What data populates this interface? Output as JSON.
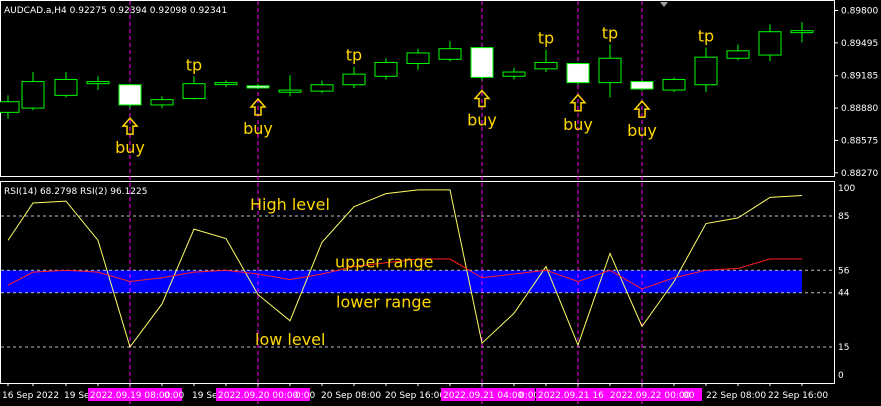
{
  "header": {
    "symbol": "AUDCAD.a,H4",
    "ohlc": "0.92275 0.92394 0.92098 0.92341"
  },
  "rsi_header": "RSI(14) 68.2798  RSI(2) 96.1225",
  "annotations": {
    "buy": "buy",
    "tp": "tp",
    "high_level": "High level",
    "upper_range": "upper range",
    "lower_range": "lower range",
    "low_level": "low level"
  },
  "colors": {
    "bull": "#00ff00",
    "bear_body": "#ffffff",
    "rsi14": "#ff2020",
    "rsi2": "#ffff66",
    "band": "#0000ff",
    "highlight": "#ff00ff",
    "annotation": "#ffd700"
  },
  "chart_data": [
    {
      "type": "candlestick",
      "series_label": "AUDCAD.a,H4",
      "y_ticks": [
        0.898,
        0.89495,
        0.89185,
        0.8888,
        0.88575,
        0.8827
      ],
      "ylim": [
        0.8824,
        0.8988
      ],
      "x_ticks": [
        "16 Sep 2022",
        "19 Sep 16:00",
        "20 Sep 08:00",
        "20 Sep 16:00",
        "22 Sep 08:00",
        "22 Sep 16:00"
      ],
      "highlighted_ticks": [
        "2022.09.19 08:00",
        "2022.09.20 00:00",
        "2022.09.21 04:00",
        "2022.09.21 16",
        "2022.09.22 00:00"
      ],
      "candles": [
        {
          "o": 0.8884,
          "h": 0.89,
          "l": 0.8878,
          "c": 0.8894
        },
        {
          "o": 0.8888,
          "h": 0.8922,
          "l": 0.8886,
          "c": 0.8913
        },
        {
          "o": 0.89,
          "h": 0.8922,
          "l": 0.8898,
          "c": 0.8915
        },
        {
          "o": 0.8911,
          "h": 0.8918,
          "l": 0.8905,
          "c": 0.8913
        },
        {
          "o": 0.891,
          "h": 0.8911,
          "l": 0.8888,
          "c": 0.8891
        },
        {
          "o": 0.8891,
          "h": 0.8899,
          "l": 0.8888,
          "c": 0.8896
        },
        {
          "o": 0.8897,
          "h": 0.8918,
          "l": 0.8896,
          "c": 0.8911
        },
        {
          "o": 0.8911,
          "h": 0.8914,
          "l": 0.8908,
          "c": 0.8912
        },
        {
          "o": 0.8909,
          "h": 0.8911,
          "l": 0.8906,
          "c": 0.8907
        },
        {
          "o": 0.8903,
          "h": 0.8919,
          "l": 0.8899,
          "c": 0.8905
        },
        {
          "o": 0.8904,
          "h": 0.8914,
          "l": 0.8902,
          "c": 0.891
        },
        {
          "o": 0.891,
          "h": 0.8927,
          "l": 0.8907,
          "c": 0.892
        },
        {
          "o": 0.8918,
          "h": 0.8935,
          "l": 0.8915,
          "c": 0.8931
        },
        {
          "o": 0.893,
          "h": 0.8944,
          "l": 0.8924,
          "c": 0.894
        },
        {
          "o": 0.8934,
          "h": 0.8951,
          "l": 0.8932,
          "c": 0.8944
        },
        {
          "o": 0.8945,
          "h": 0.8946,
          "l": 0.8914,
          "c": 0.8917
        },
        {
          "o": 0.8918,
          "h": 0.8926,
          "l": 0.8915,
          "c": 0.8922
        },
        {
          "o": 0.8925,
          "h": 0.8943,
          "l": 0.8922,
          "c": 0.8931
        },
        {
          "o": 0.893,
          "h": 0.8931,
          "l": 0.891,
          "c": 0.8912
        },
        {
          "o": 0.8912,
          "h": 0.8948,
          "l": 0.8898,
          "c": 0.8935
        },
        {
          "o": 0.8913,
          "h": 0.8914,
          "l": 0.8904,
          "c": 0.8906
        },
        {
          "o": 0.8905,
          "h": 0.8917,
          "l": 0.8903,
          "c": 0.8915
        },
        {
          "o": 0.891,
          "h": 0.8945,
          "l": 0.8903,
          "c": 0.8936
        },
        {
          "o": 0.8935,
          "h": 0.8948,
          "l": 0.8933,
          "c": 0.8942
        },
        {
          "o": 0.8938,
          "h": 0.8967,
          "l": 0.8932,
          "c": 0.896
        },
        {
          "o": 0.896,
          "h": 0.8969,
          "l": 0.895,
          "c": 0.8961
        }
      ],
      "signals": [
        {
          "candle": 4,
          "label": "buy"
        },
        {
          "candle": 8,
          "label": "buy"
        },
        {
          "candle": 15,
          "label": "buy"
        },
        {
          "candle": 18,
          "label": "buy"
        },
        {
          "candle": 20,
          "label": "buy"
        }
      ],
      "take_profits": [
        6,
        11,
        17,
        19,
        22
      ]
    },
    {
      "type": "line",
      "title": "RSI(14) 68.2798  RSI(2) 96.1225",
      "ylim": [
        0,
        100
      ],
      "y_ticks": [
        100,
        85,
        56,
        44,
        15,
        0
      ],
      "levels": [
        85,
        56,
        44,
        15
      ],
      "band": [
        44,
        56
      ],
      "series": [
        {
          "name": "RSI(2)",
          "values": [
            72,
            92,
            93,
            72,
            15,
            38,
            78,
            73,
            43,
            29,
            71,
            90,
            97,
            99,
            99,
            17,
            33,
            58,
            16,
            65,
            26,
            50,
            81,
            84,
            95,
            96
          ]
        },
        {
          "name": "RSI(14)",
          "values": [
            48,
            55,
            56,
            55,
            50,
            52,
            55,
            56,
            54,
            51,
            54,
            58,
            60,
            62,
            62,
            52,
            54,
            56,
            50,
            56,
            46,
            52,
            56,
            57,
            62,
            62
          ]
        }
      ]
    }
  ]
}
